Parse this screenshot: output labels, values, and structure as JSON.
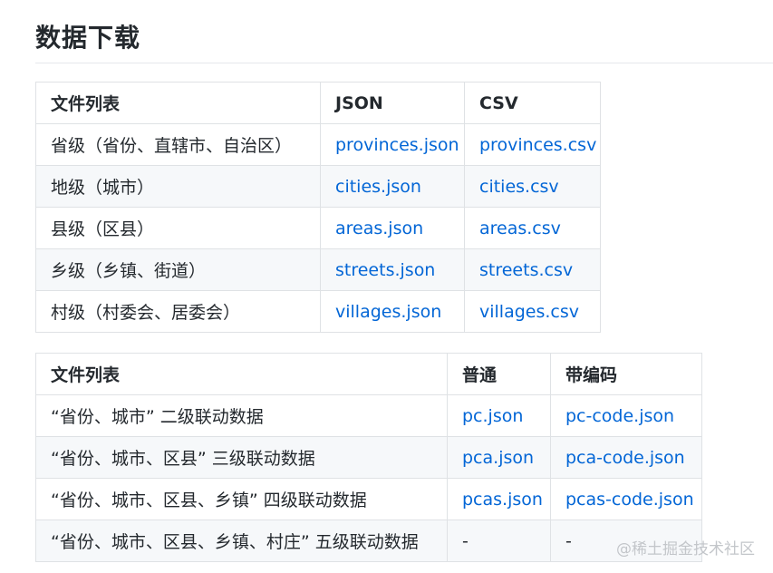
{
  "heading": "数据下载",
  "table1": {
    "headers": [
      "文件列表",
      "JSON",
      "CSV"
    ],
    "rows": [
      {
        "label": "省级（省份、直辖市、自治区）",
        "json": "provinces.json",
        "csv": "provinces.csv"
      },
      {
        "label": "地级（城市）",
        "json": "cities.json",
        "csv": "cities.csv"
      },
      {
        "label": "县级（区县）",
        "json": "areas.json",
        "csv": "areas.csv"
      },
      {
        "label": "乡级（乡镇、街道）",
        "json": "streets.json",
        "csv": "streets.csv"
      },
      {
        "label": "村级（村委会、居委会）",
        "json": "villages.json",
        "csv": "villages.csv"
      }
    ]
  },
  "table2": {
    "headers": [
      "文件列表",
      "普通",
      "带编码"
    ],
    "rows": [
      {
        "label": "“省份、城市” 二级联动数据",
        "plain": "pc.json",
        "code": "pc-code.json"
      },
      {
        "label": "“省份、城市、区县” 三级联动数据",
        "plain": "pca.json",
        "code": "pca-code.json"
      },
      {
        "label": "“省份、城市、区县、乡镇” 四级联动数据",
        "plain": "pcas.json",
        "code": "pcas-code.json"
      },
      {
        "label": "“省份、城市、区县、乡镇、村庄” 五级联动数据",
        "plain": "-",
        "code": "-"
      }
    ]
  },
  "watermark": "@稀土掘金技术社区",
  "colors": {
    "link": "#0366d6",
    "text": "#24292e",
    "border": "#dfe2e5",
    "row_alt_bg": "#f6f8fa"
  }
}
